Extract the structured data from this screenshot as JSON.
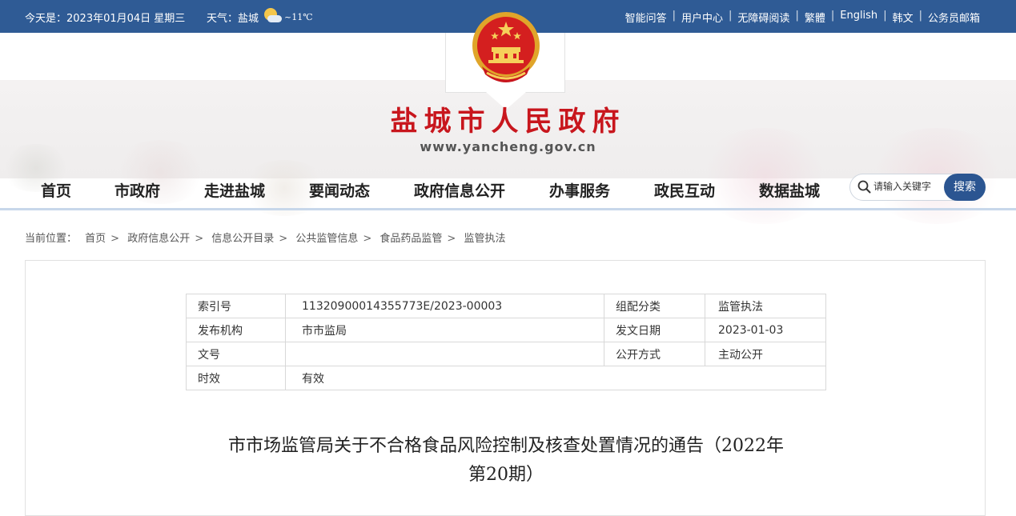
{
  "topbar": {
    "date": "今天是：2023年01月04日 星期三",
    "weather_label": "天气：",
    "weather_city": "盐城",
    "weather_temp": "~11℃",
    "links": [
      "智能问答",
      "用户中心",
      "无障碍阅读",
      "繁體",
      "English",
      "韩文",
      "公务员邮箱"
    ]
  },
  "banner": {
    "title": "盐城市人民政府",
    "url": "www.yancheng.gov.cn"
  },
  "nav": {
    "items": [
      "首页",
      "市政府",
      "走进盐城",
      "要闻动态",
      "政府信息公开",
      "办事服务",
      "政民互动",
      "数据盐城"
    ]
  },
  "search": {
    "placeholder": "请输入关键字",
    "button": "搜索"
  },
  "breadcrumb": {
    "label": "当前位置：",
    "items": [
      "首页",
      "政府信息公开",
      "信息公开目录",
      "公共监管信息",
      "食品药品监管",
      "监管执法"
    ],
    "separator": ">"
  },
  "info_table": {
    "rows": [
      {
        "k1": "索引号",
        "v1": "11320900014355773E/2023-00003",
        "k2": "组配分类",
        "v2": "监管执法"
      },
      {
        "k1": "发布机构",
        "v1": "市市监局",
        "k2": "发文日期",
        "v2": "2023-01-03"
      },
      {
        "k1": "文号",
        "v1": "",
        "k2": "公开方式",
        "v2": "主动公开"
      },
      {
        "k1": "时效",
        "v1": "有效"
      }
    ]
  },
  "document": {
    "title_line1": "市市场监管局关于不合格食品风险控制及核查处置情况的通告（2022年",
    "title_line2": "第20期）"
  },
  "colors": {
    "topbar_bg": "#2f5b95",
    "title_red": "#c8161d",
    "search_button": "#2b5591"
  },
  "icons": {
    "weather": "partly-cloudy-icon",
    "emblem": "national-emblem-icon",
    "search": "search-icon"
  }
}
